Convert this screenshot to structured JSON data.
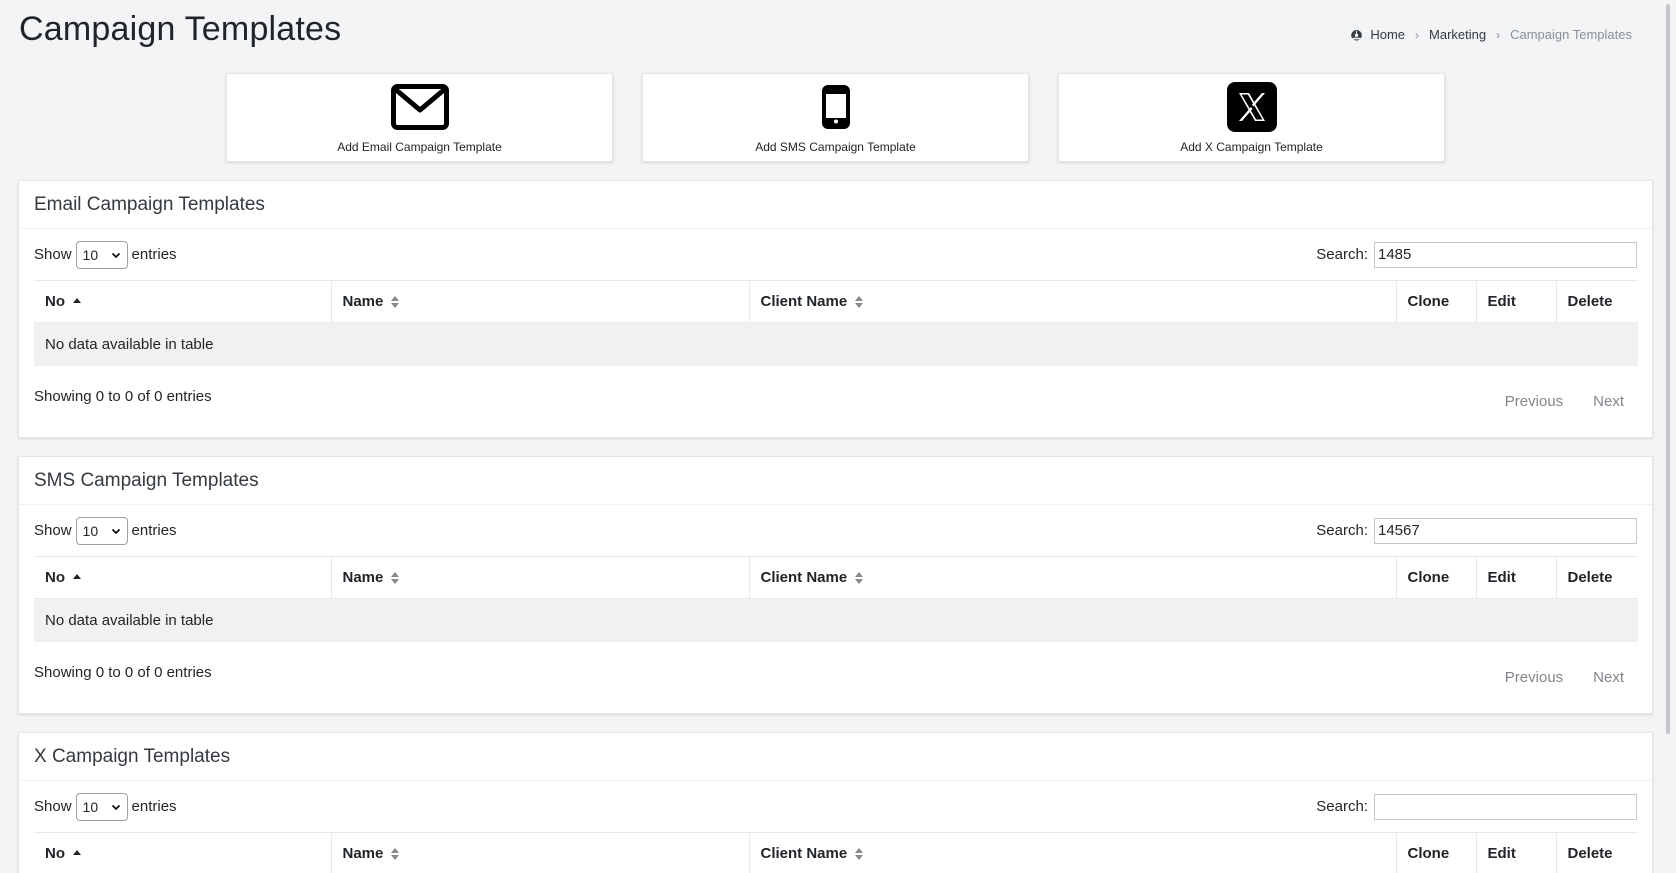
{
  "page": {
    "title": "Campaign Templates"
  },
  "breadcrumb": {
    "home": "Home",
    "marketing": "Marketing",
    "current": "Campaign Templates"
  },
  "quick_actions": {
    "email": {
      "label": "Add Email Campaign Template",
      "icon": "envelope-icon"
    },
    "sms": {
      "label": "Add SMS Campaign Template",
      "icon": "mobile-phone-icon"
    },
    "x": {
      "label": "Add X Campaign Template",
      "icon": "x-logo-icon"
    }
  },
  "common": {
    "show": "Show",
    "entries": "entries",
    "search_label": "Search:",
    "columns": {
      "no": "No",
      "name": "Name",
      "client": "Client Name",
      "clone": "Clone",
      "edit": "Edit",
      "delete": "Delete"
    },
    "empty": "No data available in table",
    "info": "Showing 0 to 0 of 0 entries",
    "previous": "Previous",
    "next": "Next"
  },
  "email_section": {
    "title": "Email Campaign Templates",
    "page_length": "10",
    "search_value": "1485"
  },
  "sms_section": {
    "title": "SMS Campaign Templates",
    "page_length": "10",
    "search_value": "14567"
  },
  "x_section": {
    "title": "X Campaign Templates",
    "page_length": "10",
    "search_value": ""
  }
}
